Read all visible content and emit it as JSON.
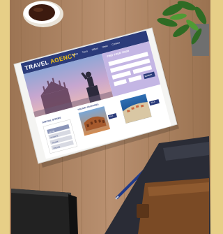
{
  "photo": {
    "subject": "tablet showing a travel agency website on a wooden desk",
    "colors": {
      "frame": "#e7cf87",
      "desk": "#b08660",
      "desk_dark": "#8c6a49",
      "tablet_body": "#f4f4f2",
      "site_nav": "#2b3b7a",
      "booking_panel": "#c4b6e4",
      "accent_yellow": "#f2c315",
      "coffee": "#3c1a0f"
    }
  },
  "website": {
    "brand_word_1": "TRAVEL",
    "brand_word_2": "AGENCY",
    "nav_items": [
      "Home",
      "Tours",
      "Offers",
      "News",
      "Contact"
    ],
    "booking_title": "FIND YOUR TOUR",
    "search_button": "SEARCH",
    "special_offers_title": "SPECIAL OFFERS",
    "special_offers_items": [
      "HOTEL",
      "FLIGHTS",
      "TOURS",
      "CRUISE"
    ],
    "holiday_packages_title": "HOLIDAY PACKAGES",
    "deal_badge_1": "SALE",
    "deal_badge_2": "SALE"
  }
}
